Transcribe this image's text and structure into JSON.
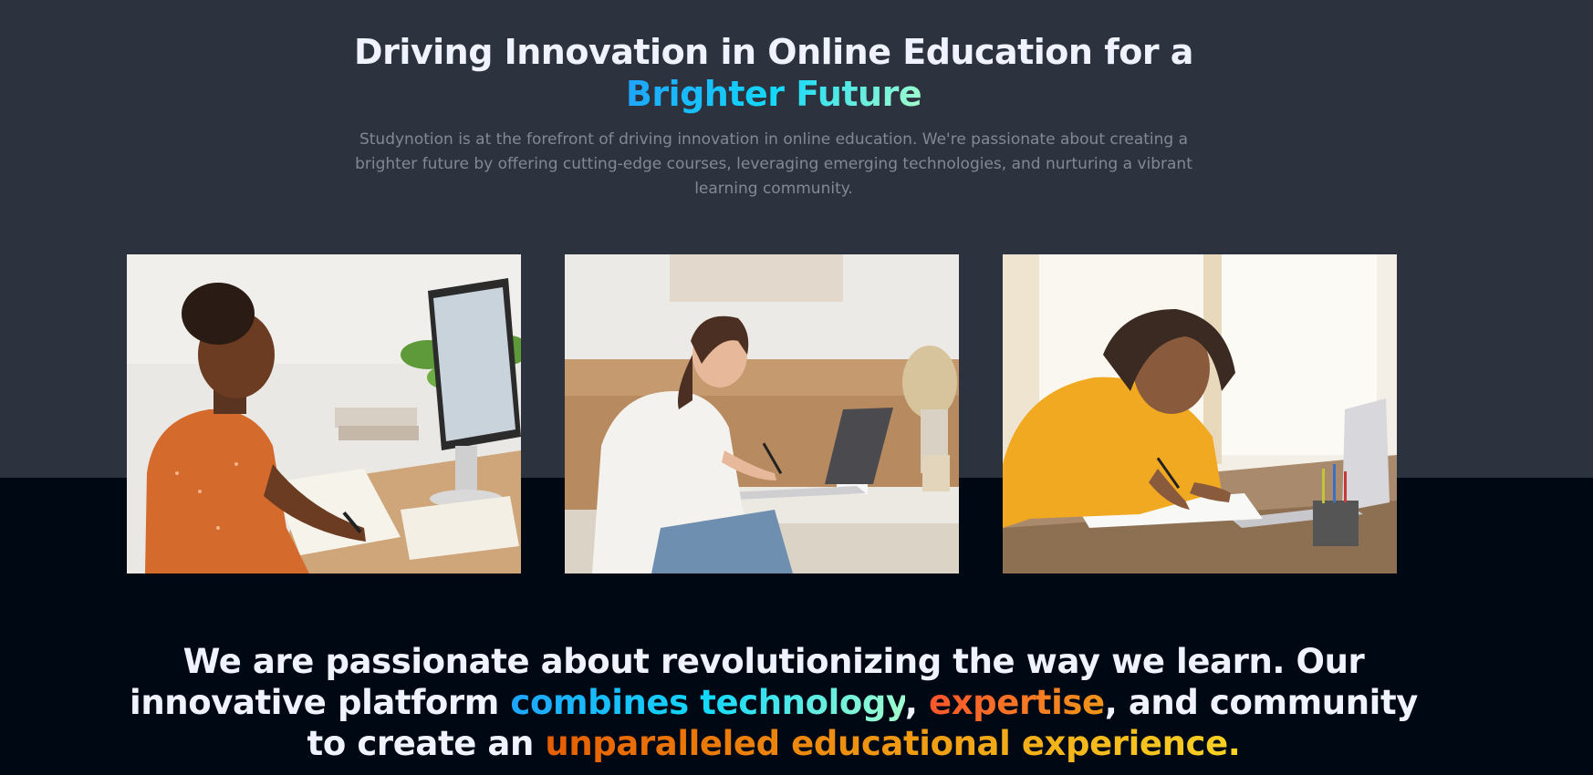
{
  "hero": {
    "title_line1": "Driving Innovation in Online Education for a",
    "title_highlight": "Brighter Future",
    "description": "Studynotion is at the forefront of driving innovation in online education. We're passionate about creating a brighter future by offering cutting-edge courses, leveraging emerging technologies, and nurturing a vibrant learning community."
  },
  "images": [
    {
      "name": "woman-studying-at-computer-photo"
    },
    {
      "name": "woman-writing-with-laptop-photo"
    },
    {
      "name": "girl-writing-at-desk-photo"
    }
  ],
  "quote": {
    "part1": "We are passionate about revolutionizing the way we learn. Our innovative platform ",
    "highlight1": "combines technology",
    "sep1": ", ",
    "highlight2": "expertise",
    "part2": ", and community to create an ",
    "highlight3": "unparalleled educational experience."
  },
  "colors": {
    "hero_background": "#2C333F",
    "page_background": "#000814",
    "title_text": "#F1F2FF",
    "description_text": "#838894",
    "accent_blue": "#12D8FA",
    "accent_orange": "#F09819",
    "accent_gold": "#F9D423"
  }
}
